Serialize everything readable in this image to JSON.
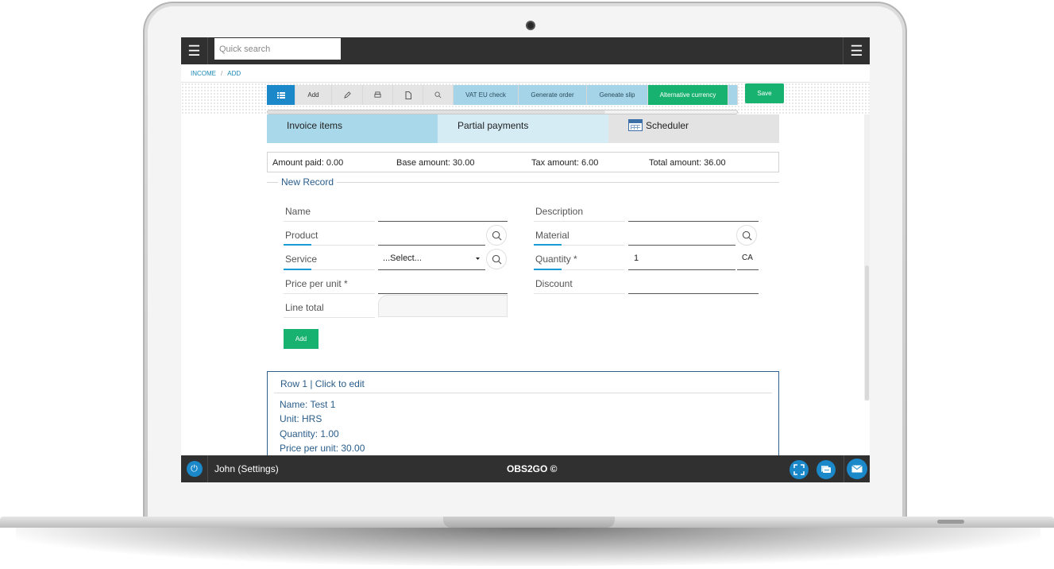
{
  "topbar": {
    "search_placeholder": "Quick search",
    "menu_icon": "hamburger-icon"
  },
  "breadcrumb": {
    "items": [
      "INCOME",
      "ADD"
    ],
    "separator": "/"
  },
  "toolbar": {
    "list_icon": "list-icon",
    "add_label": "Add",
    "edit_icon": "pencil-icon",
    "print_icon": "printer-icon",
    "pdf_icon": "document-icon",
    "search_icon": "search-icon",
    "vat_label": "VAT EU check",
    "order_label": "Generate order",
    "slip_label": "Geneate slip",
    "currency_label": "Alternative currency",
    "save_label": "Save"
  },
  "tabs": {
    "invoice_items": "Invoice items",
    "partial_payments": "Partial payments",
    "scheduler": "Scheduler"
  },
  "amounts": {
    "amount_paid": "Amount paid: 0.00",
    "base_amount": "Base amount: 30.00",
    "tax_amount": "Tax amount: 6.00",
    "total_amount": "Total amount: 36.00"
  },
  "form": {
    "legend": "New Record",
    "name_label": "Name",
    "description_label": "Description",
    "product_label": "Product",
    "material_label": "Material",
    "service_label": "Service",
    "service_value": "...Select...",
    "quantity_label": "Quantity *",
    "quantity_value": "1",
    "quantity_unit": "CA",
    "price_label": "Price per unit *",
    "discount_label": "Discount",
    "line_total_label": "Line total",
    "add_label": "Add"
  },
  "rows": [
    {
      "title": "Row 1 | Click to edit",
      "name": "Name: Test 1",
      "unit": "Unit: HRS",
      "quantity": "Quantity: 1.00",
      "price": "Price per unit: 30.00"
    }
  ],
  "footer": {
    "user": "John (Settings)",
    "brand": "OBS2GO ©"
  },
  "colors": {
    "accent_blue": "#1a88c9",
    "accent_green": "#17b26f",
    "bar_dark": "#303030",
    "label_blue": "#2a5d8a"
  }
}
